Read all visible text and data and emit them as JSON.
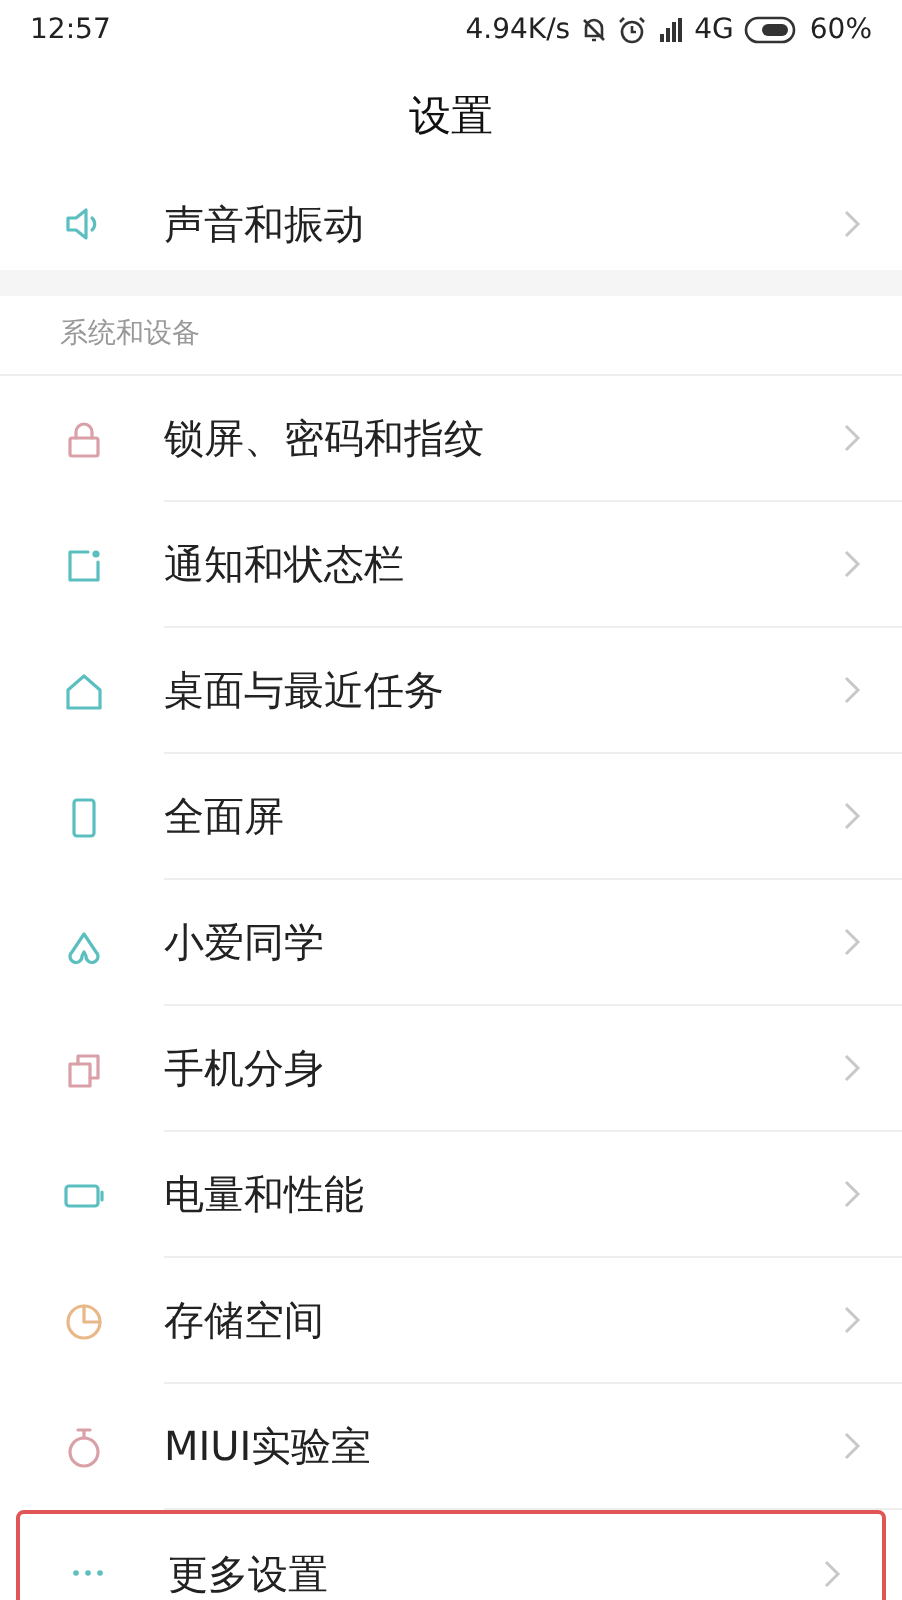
{
  "status_bar": {
    "time": "12:57",
    "speed": "4.94K/s",
    "network": "4G",
    "battery": "60%"
  },
  "title": "设置",
  "top_items": [
    {
      "label": "声音和振动",
      "kind": "sound",
      "highlighted": false
    }
  ],
  "sections": [
    {
      "header": "系统和设备",
      "items": [
        {
          "label": "锁屏、密码和指纹",
          "kind": "lock",
          "highlighted": false
        },
        {
          "label": "通知和状态栏",
          "kind": "notification",
          "highlighted": false
        },
        {
          "label": "桌面与最近任务",
          "kind": "home",
          "highlighted": false
        },
        {
          "label": "全面屏",
          "kind": "phone",
          "highlighted": false
        },
        {
          "label": "小爱同学",
          "kind": "assistant",
          "highlighted": false
        },
        {
          "label": "手机分身",
          "kind": "copy",
          "highlighted": false
        },
        {
          "label": "电量和性能",
          "kind": "battery",
          "highlighted": false
        },
        {
          "label": "存储空间",
          "kind": "pie",
          "highlighted": false
        },
        {
          "label": "MIUI实验室",
          "kind": "flask",
          "highlighted": false
        },
        {
          "label": "更多设置",
          "kind": "more",
          "highlighted": true
        }
      ]
    }
  ]
}
